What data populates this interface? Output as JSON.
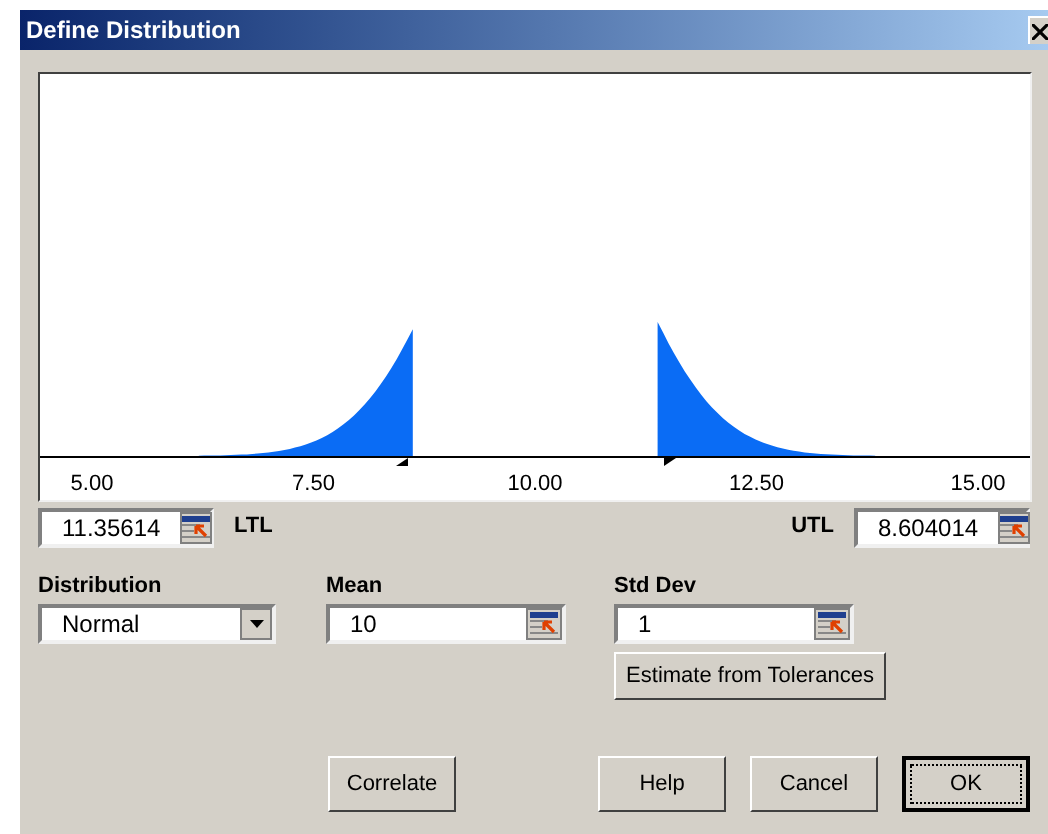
{
  "window": {
    "title": "Define Distribution"
  },
  "chart": {
    "axis_labels": [
      "5.00",
      "7.50",
      "10.00",
      "12.50",
      "15.00"
    ]
  },
  "ltl": {
    "label": "LTL",
    "value": "11.35614"
  },
  "utl": {
    "label": "UTL",
    "value": "8.604014"
  },
  "distribution": {
    "label": "Distribution",
    "value": "Normal"
  },
  "mean": {
    "label": "Mean",
    "value": "10"
  },
  "std_dev": {
    "label": "Std Dev",
    "value": "1"
  },
  "estimate_button": "Estimate from Tolerances",
  "buttons": [
    {
      "label": "Correlate",
      "default": false
    },
    {
      "label": "Help",
      "default": false
    },
    {
      "label": "Cancel",
      "default": false
    },
    {
      "label": "OK",
      "default": true
    }
  ]
}
